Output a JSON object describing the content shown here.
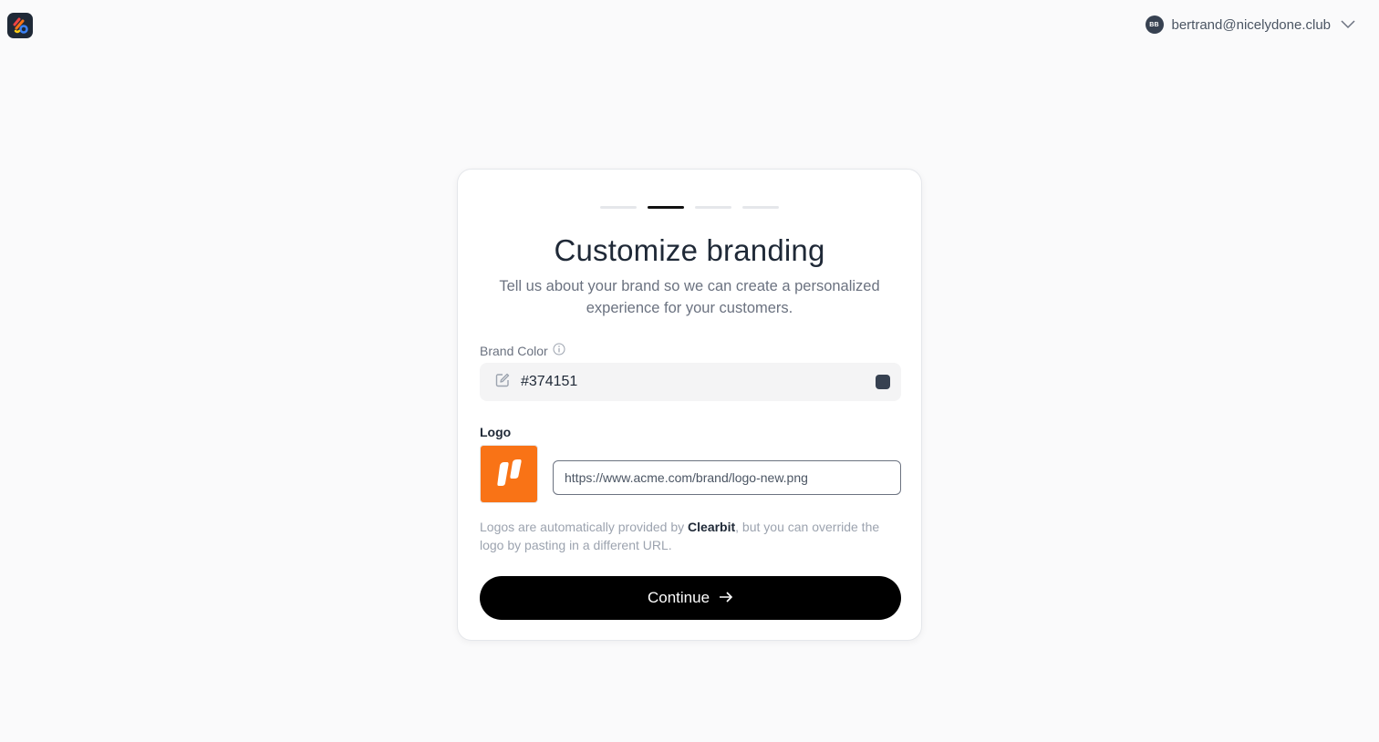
{
  "header": {
    "account": {
      "initials": "BB",
      "email": "bertrand@nicelydone.club"
    }
  },
  "onboarding": {
    "steps": {
      "total": 4,
      "current": 2
    },
    "title": "Customize branding",
    "subtitle": "Tell us about your brand so we can create a personalized experience for your customers.",
    "brand_color": {
      "label": "Brand Color",
      "value": "#374151",
      "swatch_color": "#374151"
    },
    "logo": {
      "label": "Logo",
      "url_value": "https://www.acme.com/brand/logo-new.png",
      "preview_color": "#f97316"
    },
    "hint": {
      "prefix": "Logos are automatically provided by ",
      "provider": "Clearbit",
      "suffix": ", but you can override the logo by pasting in a different URL."
    },
    "continue_label": "Continue"
  },
  "icons": {
    "app": "app-logo-icon",
    "info": "info-icon",
    "edit": "pencil-square-icon",
    "chevron": "chevron-down-icon",
    "arrow": "arrow-right-icon"
  }
}
